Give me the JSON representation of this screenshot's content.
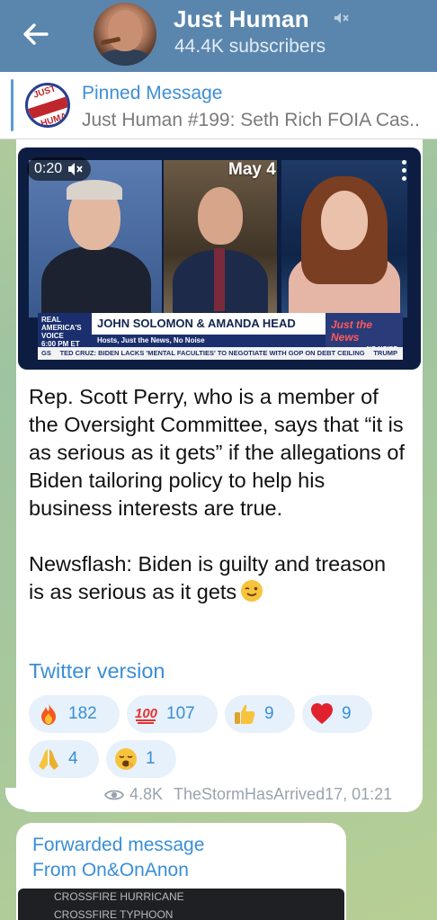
{
  "header": {
    "title": "Just Human",
    "subtitle": "44.4K subscribers"
  },
  "pinned": {
    "title": "Pinned Message",
    "text": "Just Human #199: Seth Rich FOIA Cas..",
    "logo_text_top": "JUST",
    "logo_text_bottom": "HUMAN"
  },
  "message": {
    "video": {
      "time": "0:20",
      "date_overlay": "May 4",
      "lower_third_logo": "REAL AMERICA'S VOICE",
      "lower_third_title": "JOHN SOLOMON & AMANDA HEAD",
      "lower_third_subtitle": "Hosts, Just the News, No Noise",
      "lower_third_time": "6:00 PM ET",
      "badge_title": "Just the News",
      "badge_sub": "NO NOISE",
      "ticker_left": "GS",
      "ticker": "TED CRUZ: BIDEN LACKS 'MENTAL FACULTIES' TO NEGOTIATE WITH GOP ON DEBT CEILING",
      "ticker_right": "TRUMP"
    },
    "paragraph1": "Rep. Scott Perry, who is a member of the Oversight Committee, says that “it is as serious as it gets” if the allegations of Biden tailoring policy to help his business interests are true.",
    "paragraph2": "Newsflash: Biden is guilty and treason is as serious as it gets",
    "link": "Twitter version",
    "reactions": [
      {
        "emoji": "fire",
        "count": "182"
      },
      {
        "emoji": "hundred",
        "count": "107"
      },
      {
        "emoji": "thumbs-up",
        "count": "9"
      },
      {
        "emoji": "heart",
        "count": "9"
      },
      {
        "emoji": "folded-hands",
        "count": "4"
      },
      {
        "emoji": "yawning-face",
        "count": "1"
      }
    ],
    "views": "4.8K",
    "footer": "TheStormHasArrived17, 01:21"
  },
  "forwarded": {
    "label": "Forwarded message",
    "from": "From On&OnAnon",
    "media_line1": "CROSSFIRE HURRICANE",
    "media_line2": "CROSSFIRE TYPHOON"
  },
  "colors": {
    "header_bg": "#5a86ad",
    "accent": "#3a8ed6",
    "reaction_bg": "#e6f1fb"
  }
}
